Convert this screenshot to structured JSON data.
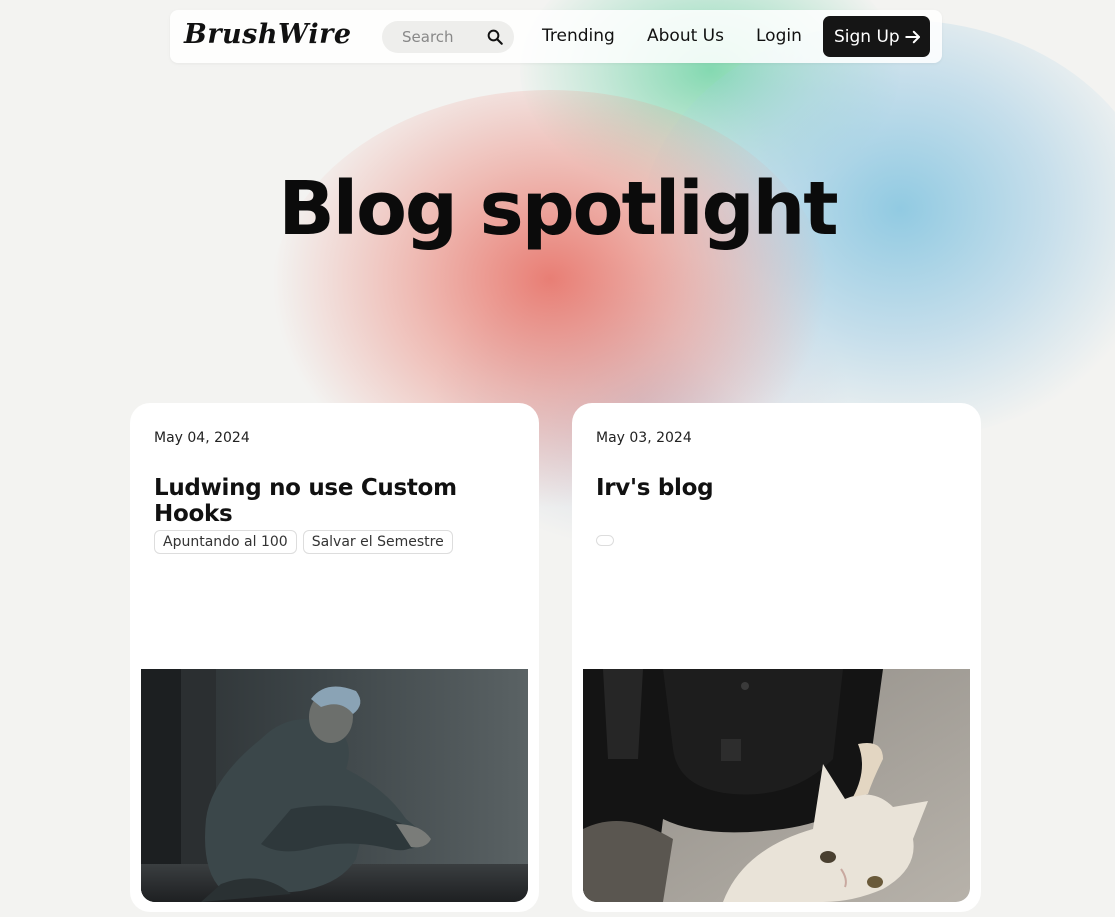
{
  "navbar": {
    "logo": "BrushWire",
    "search_placeholder": "Search",
    "links": {
      "trending": "Trending",
      "about": "About Us",
      "login": "Login"
    },
    "signup_label": "Sign Up"
  },
  "hero": {
    "title": "Blog spotlight"
  },
  "posts": [
    {
      "date": "May 04, 2024",
      "title": "Ludwing no use Custom Hooks",
      "tags": [
        "Apuntando al 100",
        "Salvar el Semestre"
      ],
      "image_icon": "sad-man-illustration"
    },
    {
      "date": "May 03, 2024",
      "title": "Irv's blog",
      "tags": [
        ""
      ],
      "image_icon": "cat-photo"
    }
  ],
  "colors": {
    "button_bg": "#151515",
    "page_bg": "#f3f3f1",
    "card_bg": "#ffffff"
  }
}
